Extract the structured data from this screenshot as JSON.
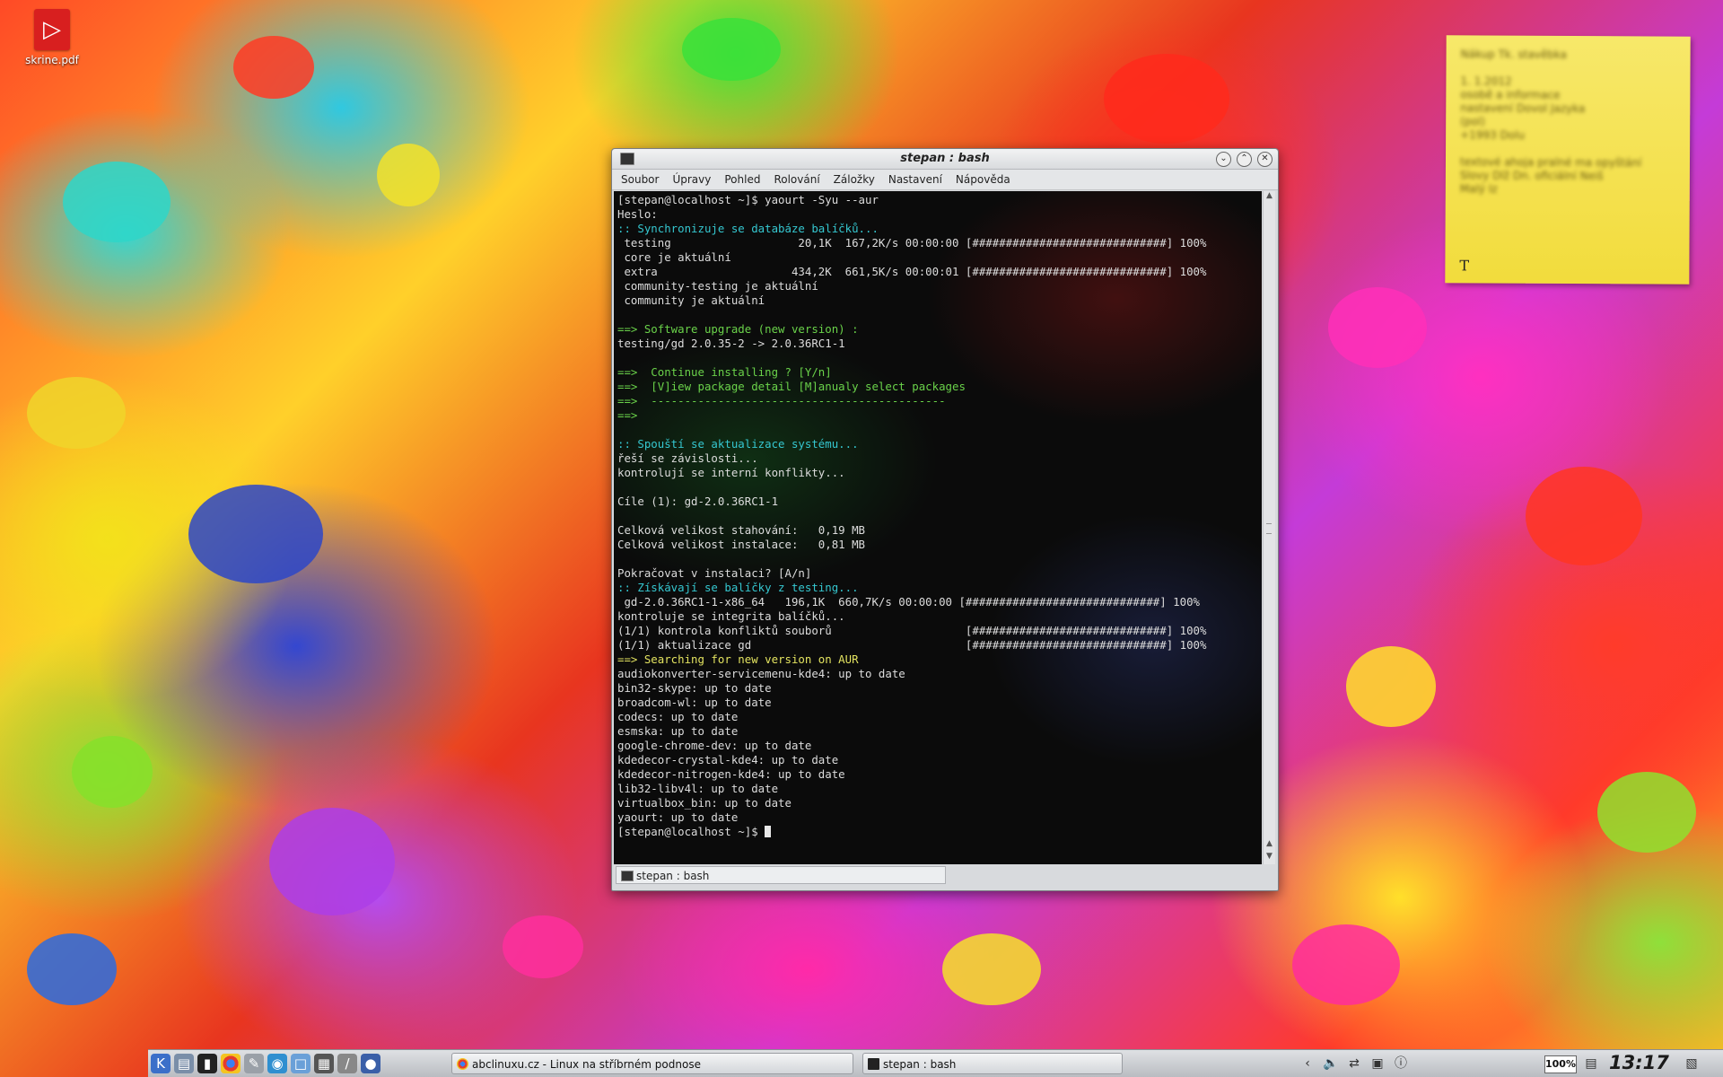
{
  "desktop": {
    "icon_label": "skrine.pdf"
  },
  "note": {
    "blurred_lines": [
      "Nákup Tk. stavěbka",
      "",
      "1. 1.2012",
      "osobě a informace",
      "nastavení Dovol Jazyka",
      "(pol)",
      "+1993 Dolu",
      "",
      "textové ahoja pralné ma opyštání",
      "Slovy Dlž Dn. oficiální Neiš",
      "Malý Iz"
    ],
    "text_button": "T"
  },
  "window": {
    "title": "stepan : bash",
    "menu": [
      "Soubor",
      "Úpravy",
      "Pohled",
      "Rolování",
      "Záložky",
      "Nastavení",
      "Nápověda"
    ],
    "tab_label": "stepan : bash"
  },
  "terminal": {
    "lines": [
      "[stepan@localhost ~]$ yaourt -Syu --aur",
      "Heslo:",
      ":: Synchronizuje se databáze balíčků...",
      " testing                   20,1K  167,2K/s 00:00:00 [#############################] 100%",
      " core je aktuální",
      " extra                    434,2K  661,5K/s 00:00:01 [#############################] 100%",
      " community-testing je aktuální",
      " community je aktuální",
      "",
      "==> Software upgrade (new version) :",
      "testing/gd 2.0.35-2 -> 2.0.36RC1-1",
      "",
      "==>  Continue installing ? [Y/n]",
      "==>  [V]iew package detail [M]anualy select packages",
      "==>  --------------------------------------------",
      "==>",
      "",
      ":: Spouští se aktualizace systému...",
      "řeší se závislosti...",
      "kontrolují se interní konflikty...",
      "",
      "Cíle (1): gd-2.0.36RC1-1",
      "",
      "Celková velikost stahování:   0,19 MB",
      "Celková velikost instalace:   0,81 MB",
      "",
      "Pokračovat v instalaci? [A/n]",
      ":: Získávají se balíčky z testing...",
      " gd-2.0.36RC1-1-x86_64   196,1K  660,7K/s 00:00:00 [#############################] 100%",
      "kontroluje se integrita balíčků...",
      "(1/1) kontrola konfliktů souborů                    [#############################] 100%",
      "(1/1) aktualizace gd                                [#############################] 100%",
      "==> Searching for new version on AUR",
      "audiokonverter-servicemenu-kde4: up to date",
      "bin32-skype: up to date",
      "broadcom-wl: up to date",
      "codecs: up to date",
      "esmska: up to date",
      "google-chrome-dev: up to date",
      "kdedecor-crystal-kde4: up to date",
      "kdedecor-nitrogen-kde4: up to date",
      "lib32-libv4l: up to date",
      "virtualbox_bin: up to date",
      "yaourt: up to date",
      "[stepan@localhost ~]$ "
    ],
    "line_colors": {
      "2": "c-cyan",
      "9": "c-green",
      "12": "c-green",
      "13": "c-green",
      "14": "c-green",
      "15": "c-green",
      "17": "c-cyan",
      "27": "c-cyan",
      "32": "c-yellow"
    }
  },
  "taskbar": {
    "launchers": [
      "kde-menu-icon",
      "file-manager-icon",
      "terminal-icon",
      "chrome-icon",
      "image-editor-icon",
      "browser-icon",
      "package-icon",
      "calculator-icon",
      "pen-icon",
      "network-icon"
    ],
    "tasks": [
      {
        "label": "abclinuxu.cz - Linux na stříbrném podnose",
        "icon": "chrome-icon"
      },
      {
        "label": "stepan : bash",
        "icon": "terminal-icon"
      }
    ],
    "battery": "100%",
    "clock": "13:17"
  }
}
